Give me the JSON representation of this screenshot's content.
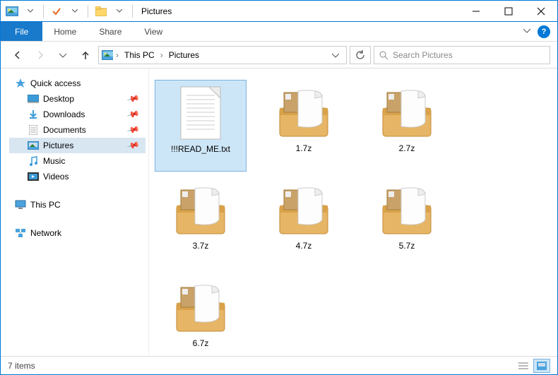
{
  "window": {
    "title": "Pictures"
  },
  "ribbon": {
    "file": "File",
    "tabs": [
      "Home",
      "Share",
      "View"
    ]
  },
  "breadcrumb": {
    "segments": [
      "This PC",
      "Pictures"
    ]
  },
  "search": {
    "placeholder": "Search Pictures"
  },
  "sidebar": {
    "quickAccess": {
      "label": "Quick access",
      "items": [
        {
          "label": "Desktop",
          "pinned": true
        },
        {
          "label": "Downloads",
          "pinned": true
        },
        {
          "label": "Documents",
          "pinned": true
        },
        {
          "label": "Pictures",
          "pinned": true,
          "selected": true
        },
        {
          "label": "Music",
          "pinned": false
        },
        {
          "label": "Videos",
          "pinned": false
        }
      ]
    },
    "thisPC": {
      "label": "This PC"
    },
    "network": {
      "label": "Network"
    }
  },
  "files": [
    {
      "name": "!!!READ_ME.txt",
      "type": "txt",
      "selected": true
    },
    {
      "name": "1.7z",
      "type": "archive"
    },
    {
      "name": "2.7z",
      "type": "archive"
    },
    {
      "name": "3.7z",
      "type": "archive"
    },
    {
      "name": "4.7z",
      "type": "archive"
    },
    {
      "name": "5.7z",
      "type": "archive"
    },
    {
      "name": "6.7z",
      "type": "archive"
    }
  ],
  "status": {
    "itemCount": "7 items"
  }
}
